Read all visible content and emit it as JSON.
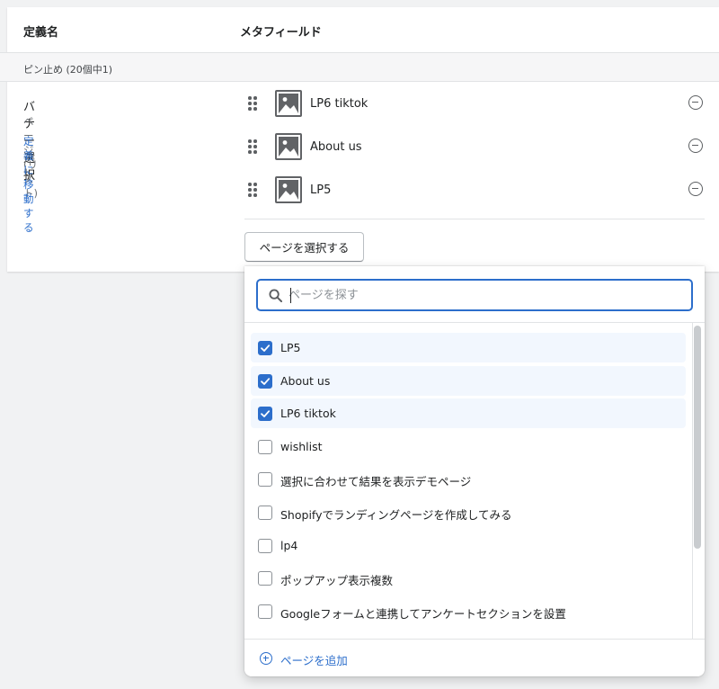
{
  "header": {
    "col_definition": "定義名",
    "col_metafield": "メタフィールド"
  },
  "pinned": {
    "label": "ピン止め (20個中1)"
  },
  "definition": {
    "name": "バナー選択",
    "type": "ページ (リスト)",
    "link": "定義に移動する"
  },
  "metafield_items": [
    {
      "label": "LP6 tiktok",
      "icon": "image-icon"
    },
    {
      "label": "About us",
      "icon": "image-icon"
    },
    {
      "label": "LP5",
      "icon": "image-icon"
    }
  ],
  "select_button": "ページを選択する",
  "popover": {
    "search_placeholder": "ページを探す",
    "options": [
      {
        "label": "LP5",
        "checked": true
      },
      {
        "label": "About us",
        "checked": true
      },
      {
        "label": "LP6 tiktok",
        "checked": true
      },
      {
        "label": "wishlist",
        "checked": false
      },
      {
        "label": "選択に合わせて結果を表示デモページ",
        "checked": false
      },
      {
        "label": "Shopifyでランディングページを作成してみる",
        "checked": false
      },
      {
        "label": "lp4",
        "checked": false
      },
      {
        "label": "ポップアップ表示複数",
        "checked": false
      },
      {
        "label": "Googleフォームと連携してアンケートセクションを設置",
        "checked": false
      }
    ],
    "add_page": "ページを追加"
  },
  "colors": {
    "accent": "#2c6ecb",
    "checked_row_bg": "#f2f7fe",
    "icon_gray": "#5c5f62"
  }
}
